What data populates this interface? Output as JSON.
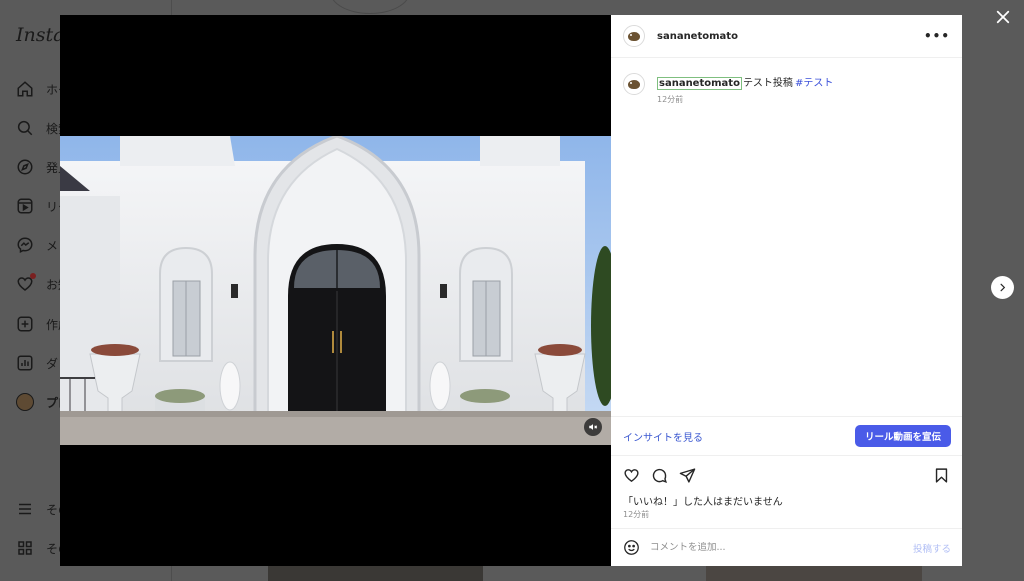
{
  "background": {
    "logo": "Instag",
    "nav_items": [
      {
        "icon": "home-icon",
        "label": "ホー"
      },
      {
        "icon": "search-icon",
        "label": "検索"
      },
      {
        "icon": "explore-icon",
        "label": "発見"
      },
      {
        "icon": "reels-icon",
        "label": "リー"
      },
      {
        "icon": "messenger-icon",
        "label": "メ"
      },
      {
        "icon": "heart-icon",
        "label": "お知"
      },
      {
        "icon": "create-icon",
        "label": "作成"
      },
      {
        "icon": "dashboard-icon",
        "label": "ダ"
      },
      {
        "icon": "profile-avatar",
        "label": "プロ"
      }
    ],
    "bottom_items": [
      {
        "icon": "menu-icon",
        "label": "その"
      },
      {
        "icon": "apps-icon",
        "label": "その"
      }
    ]
  },
  "post": {
    "username": "sananetomato",
    "caption_text": "テスト投稿",
    "hashtag": "#テスト",
    "caption_time": "12分前",
    "insights_label": "インサイトを見る",
    "promote_label": "リール動画を宣伝",
    "likes_text": "「いいね！」した人はまだいません",
    "post_time": "12分前",
    "comment_placeholder": "コメントを追加...",
    "post_button": "投稿する"
  },
  "colors": {
    "accent": "#4a5be8",
    "link": "#3a57d0",
    "hashtag": "#3a4fd9",
    "muted": "#8e8e8e"
  }
}
